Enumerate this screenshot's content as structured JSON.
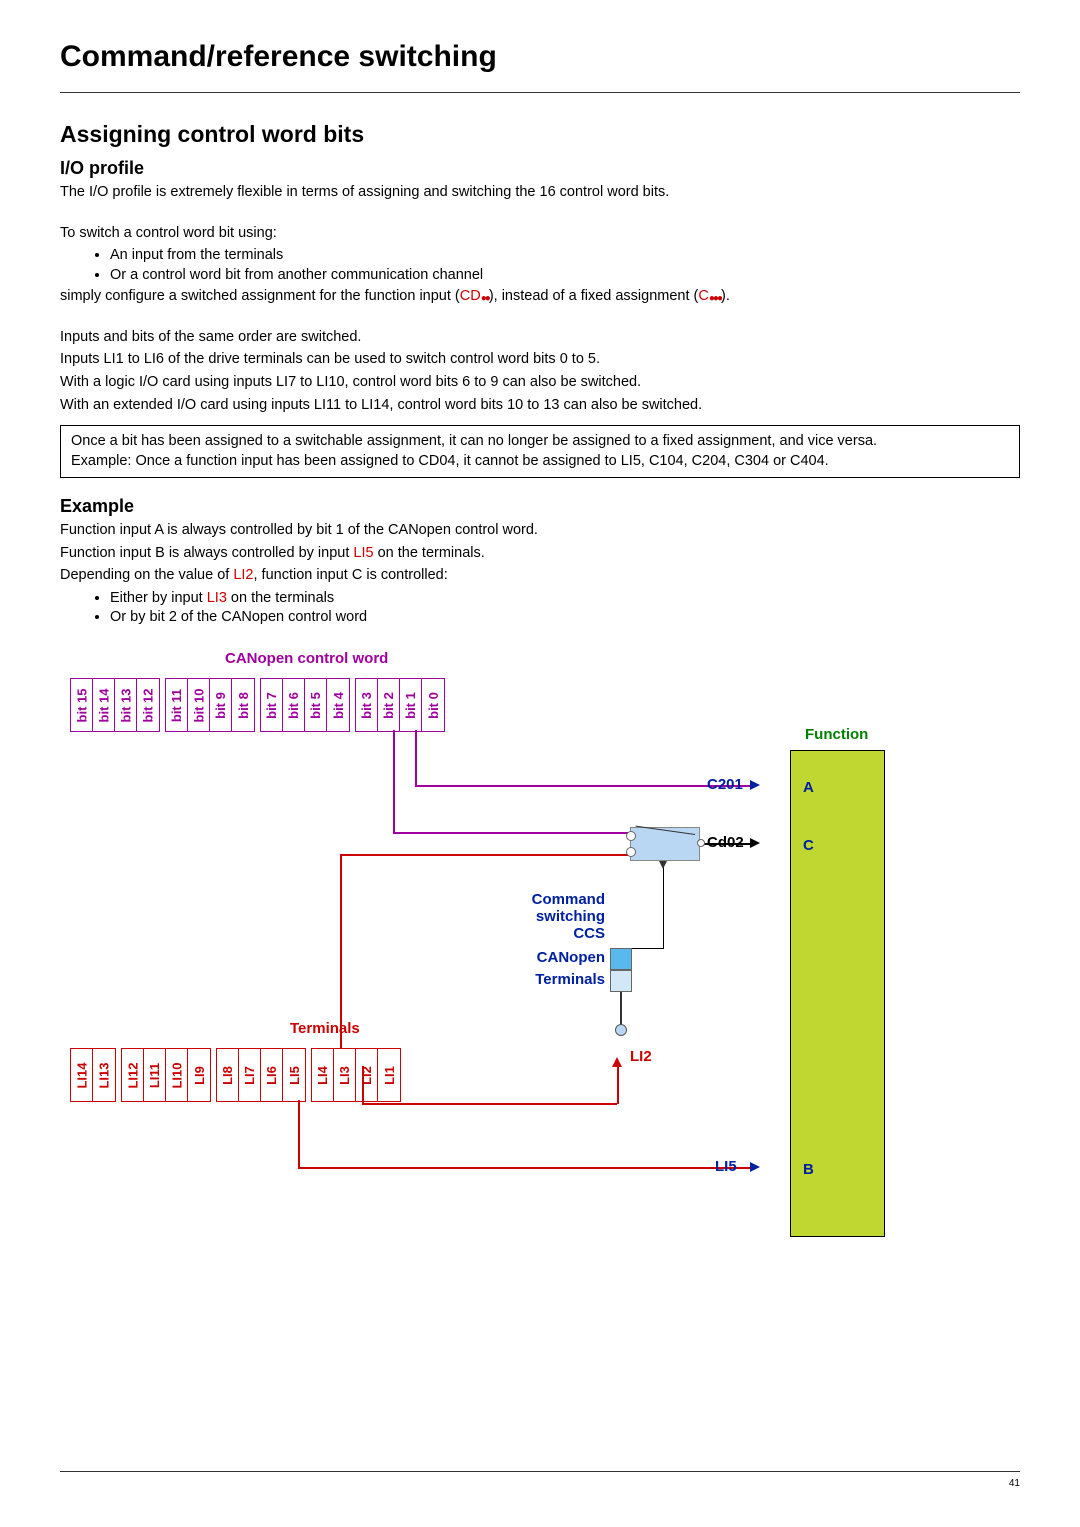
{
  "page": {
    "title": "Command/reference switching",
    "number": "41"
  },
  "section1": {
    "heading": "Assigning control word bits",
    "sub1": "I/O profile",
    "p1": "The I/O profile is extremely flexible in terms of assigning and switching the 16 control word bits.",
    "p2": "To switch a control word bit using:",
    "b1": "An input from the terminals",
    "b2": "Or a control word bit from another communication channel",
    "p3a": "simply configure a switched assignment for the function input (",
    "cd": "CD",
    "p3b": "), instead of a fixed assignment (",
    "c": "C",
    "p3c": ").",
    "p4": "Inputs and bits of the same order are switched.",
    "p5": "Inputs LI1 to LI6 of the drive terminals can be used to switch control word bits 0 to 5.",
    "p6": "With a logic I/O card using inputs LI7 to LI10, control word bits 6 to 9 can also be switched.",
    "p7": "With an extended I/O card using inputs LI11 to LI14, control word bits 10 to 13 can also be switched.",
    "note1": "Once a bit has been assigned to a switchable assignment, it can no longer be assigned to a fixed assignment, and vice versa.",
    "note2": "Example: Once a function input has been assigned to CD04, it cannot be assigned to LI5, C104, C204, C304 or C404."
  },
  "example": {
    "heading": "Example",
    "p1": "Function input A is always controlled by bit 1 of the CANopen control word.",
    "p2a": "Function input B is always controlled by input ",
    "p2b": "LI5",
    "p2c": " on the terminals.",
    "p3a": "Depending on the value of ",
    "p3b": "LI2",
    "p3c": ", function input C is controlled:",
    "b1a": "Either by input ",
    "b1b": "LI3",
    "b1c": " on the terminals",
    "b2": "Or by bit 2 of the CANopen control word"
  },
  "diagram": {
    "canopen_title": "CANopen control word",
    "bits": [
      "bit 15",
      "bit 14",
      "bit 13",
      "bit 12",
      "bit 11",
      "bit 10",
      "bit 9",
      "bit 8",
      "bit 7",
      "bit 6",
      "bit 5",
      "bit 4",
      "bit 3",
      "bit 2",
      "bit 1",
      "bit 0"
    ],
    "function_title": "Function",
    "funcA": "A",
    "funcB": "B",
    "funcC": "C",
    "c201": "C201",
    "cd02": "Cd02",
    "li5": "LI5",
    "ccs_line1": "Command",
    "ccs_line2": "switching",
    "ccs_line3": "CCS",
    "canopen_label": "CANopen",
    "terminals_label": "Terminals",
    "terminals_title": "Terminals",
    "li2_label": "LI2",
    "li": [
      "LI14",
      "LI13",
      "LI12",
      "LI11",
      "LI10",
      "LI9",
      "LI8",
      "LI7",
      "LI6",
      "LI5",
      "LI4",
      "LI3",
      "LI2",
      "LI1"
    ]
  }
}
